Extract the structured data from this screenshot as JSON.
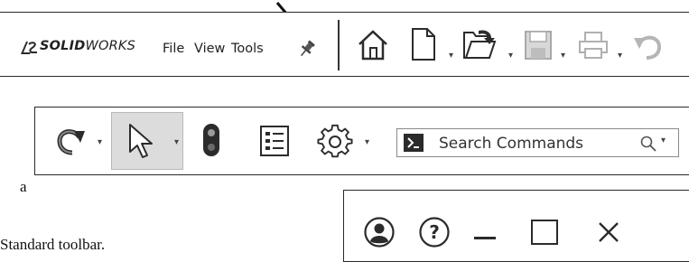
{
  "brand": {
    "name_bold": "SOLID",
    "name_rest": "WORKS"
  },
  "menu": {
    "file": "File",
    "view": "View",
    "tools": "Tools"
  },
  "icons": {
    "pin": "pin-icon",
    "home": "home-icon",
    "new_doc": "new-document-icon",
    "open": "open-folder-icon",
    "save": "save-icon",
    "print": "print-icon",
    "undo": "undo-icon",
    "redo": "redo-icon",
    "select": "select-arrow-icon",
    "traffic": "traffic-light-icon",
    "options_list": "list-options-icon",
    "settings": "gear-icon",
    "terminal": "command-prompt-icon",
    "search": "search-icon",
    "user": "user-account-icon",
    "help": "help-icon",
    "minimize": "minimize-icon",
    "maximize": "maximize-icon",
    "close": "close-icon",
    "annotation_arrow": "pointer-arrow-icon"
  },
  "search": {
    "placeholder": "Search Commands"
  },
  "page_text": {
    "fragment_a": "a",
    "fragment_b": "Standard toolbar."
  },
  "colors": {
    "toolbar_bg": "#ffffff",
    "selected_button": "#dcdcdc",
    "border": "#2a2a2a",
    "icon_dark": "#2b2b2b",
    "icon_disabled": "#b5b5b5"
  }
}
